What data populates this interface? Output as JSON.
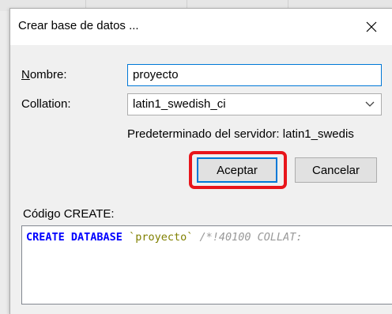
{
  "dialog": {
    "title": "Crear base de datos ...",
    "close_icon": "close-icon"
  },
  "form": {
    "name_label_accesskey": "N",
    "name_label_rest": "ombre:",
    "name_value": "proyecto",
    "collation_label": "Collation:",
    "collation_value": "latin1_swedish_ci",
    "server_default_text": "Predeterminado del servidor: latin1_swedis"
  },
  "buttons": {
    "accept_label": "Aceptar",
    "cancel_label": "Cancelar"
  },
  "code": {
    "label": "Código CREATE:",
    "keyword": "CREATE DATABASE",
    "identifier": "`proyecto`",
    "comment": "/*!40100 COLLAT:"
  },
  "colors": {
    "highlight": "#e8151b",
    "focus_border": "#0078d7",
    "sql_keyword": "#0000ff",
    "sql_identifier": "#808000",
    "sql_comment": "#999999"
  }
}
